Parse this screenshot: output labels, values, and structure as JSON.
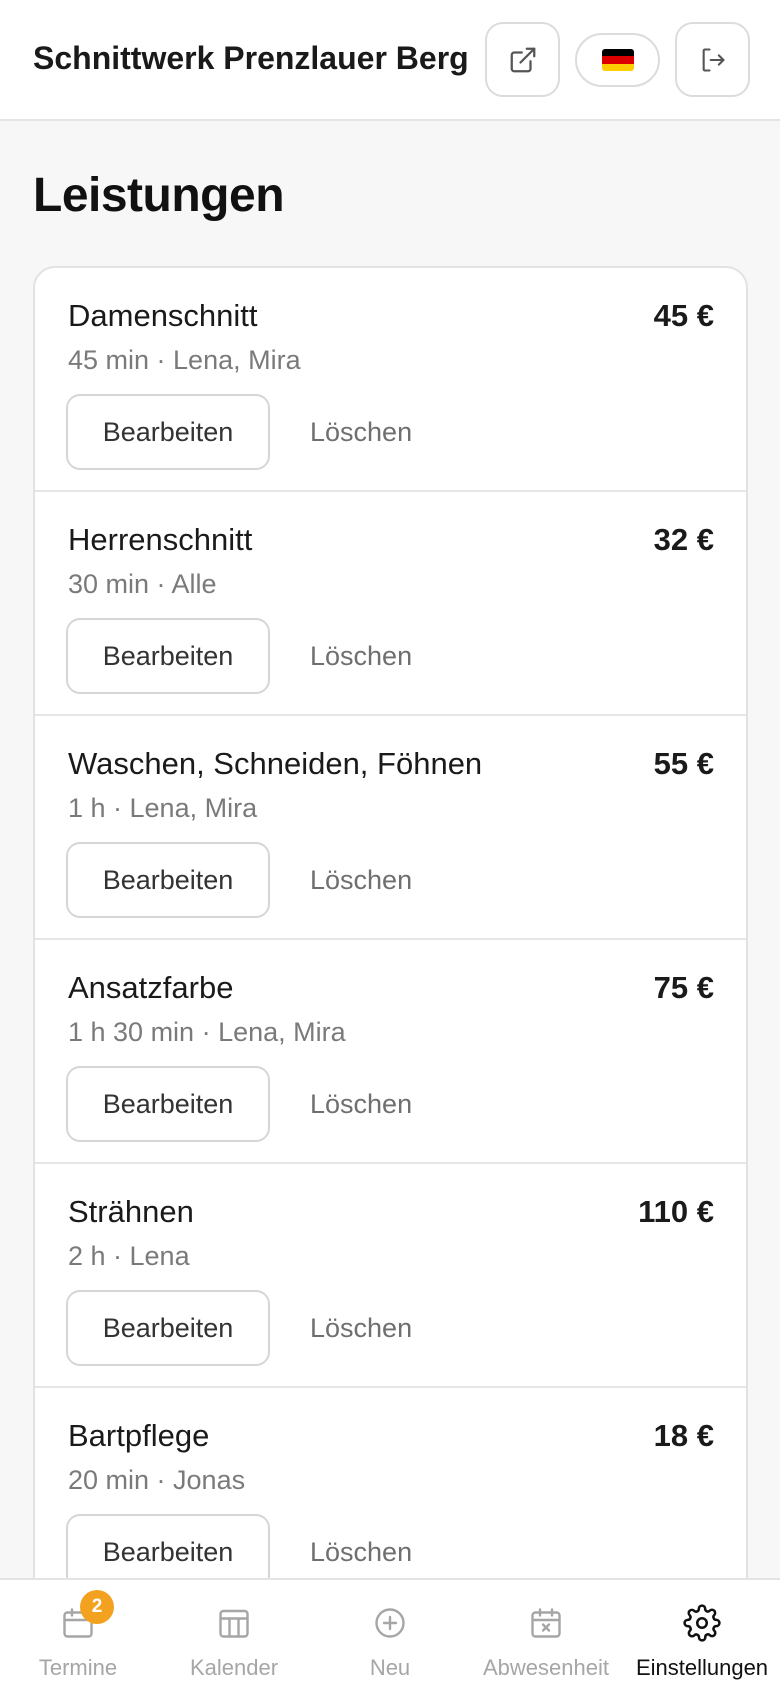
{
  "header": {
    "title": "Schnittwerk Prenzlauer Berg",
    "share_icon": "external-link-icon",
    "language_icon": "flag-de-icon",
    "logout_icon": "logout-icon"
  },
  "page": {
    "title": "Leistungen"
  },
  "services": [
    {
      "name": "Damenschnitt",
      "meta": "45 min · Lena, Mira",
      "price": "45 €",
      "edit_label": "Bearbeiten",
      "delete_label": "Löschen"
    },
    {
      "name": "Herrenschnitt",
      "meta": "30 min · Alle",
      "price": "32 €",
      "edit_label": "Bearbeiten",
      "delete_label": "Löschen"
    },
    {
      "name": "Waschen, Schneiden, Föhnen",
      "meta": "1 h · Lena, Mira",
      "price": "55 €",
      "edit_label": "Bearbeiten",
      "delete_label": "Löschen"
    },
    {
      "name": "Ansatzfarbe",
      "meta": "1 h 30 min · Lena, Mira",
      "price": "75 €",
      "edit_label": "Bearbeiten",
      "delete_label": "Löschen"
    },
    {
      "name": "Strähnen",
      "meta": "2 h · Lena",
      "price": "110 €",
      "edit_label": "Bearbeiten",
      "delete_label": "Löschen"
    },
    {
      "name": "Bartpflege",
      "meta": "20 min · Jonas",
      "price": "18 €",
      "edit_label": "Bearbeiten",
      "delete_label": "Löschen"
    }
  ],
  "nav": {
    "items": [
      {
        "label": "Termine",
        "icon": "calendar-icon",
        "badge": "2"
      },
      {
        "label": "Kalender",
        "icon": "calendar-grid-icon"
      },
      {
        "label": "Neu",
        "icon": "plus-circle-icon"
      },
      {
        "label": "Abwesenheit",
        "icon": "calendar-x-icon"
      },
      {
        "label": "Einstellungen",
        "icon": "gear-icon"
      }
    ],
    "active": "Einstellungen"
  },
  "colors": {
    "badge": "#f3a21f",
    "active_nav": "#111111",
    "inactive_nav": "#a6a6a6"
  }
}
